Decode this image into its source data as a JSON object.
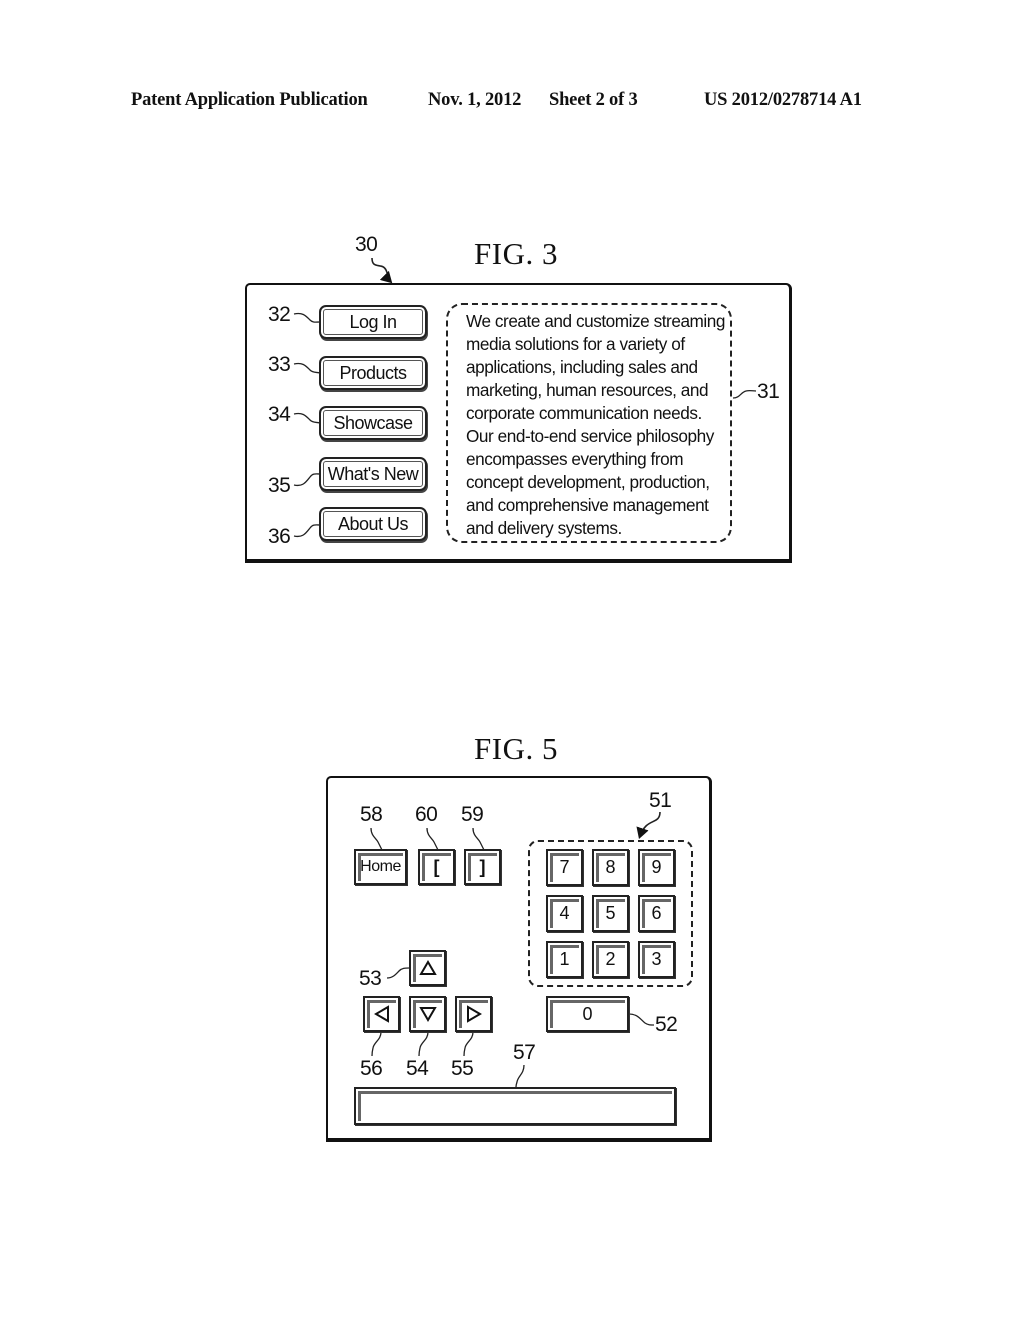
{
  "header": {
    "publication_type": "Patent Application Publication",
    "date": "Nov. 1, 2012",
    "sheet": "Sheet 2 of 3",
    "publication_number": "US 2012/0278714 A1"
  },
  "fig3": {
    "title": "FIG. 3",
    "ref_window": "30",
    "ref_text_area": "31",
    "nav_buttons": [
      {
        "ref": "32",
        "label": "Log In"
      },
      {
        "ref": "33",
        "label": "Products"
      },
      {
        "ref": "34",
        "label": "Showcase"
      },
      {
        "ref": "35",
        "label": "What's New"
      },
      {
        "ref": "36",
        "label": "About Us"
      }
    ],
    "text_lines": [
      "We create and customize streaming",
      "media solutions for a variety of",
      "applications, including sales and",
      "marketing, human resources, and",
      "corporate communication needs.",
      "Our end-to-end service philosophy",
      "encompasses everything from",
      "concept development, production,",
      "and comprehensive management",
      "and delivery systems."
    ]
  },
  "fig5": {
    "title": "FIG. 5",
    "ref_keypad": "51",
    "ref_zero": "52",
    "ref_up": "53",
    "ref_down": "54",
    "ref_right": "55",
    "ref_left": "56",
    "ref_text_field": "57",
    "ref_home": "58",
    "ref_right_bracket": "59",
    "ref_left_bracket": "60",
    "home_label": "Home",
    "left_bracket_label": "[",
    "right_bracket_label": "]",
    "keypad_keys": [
      "7",
      "8",
      "9",
      "4",
      "5",
      "6",
      "1",
      "2",
      "3"
    ],
    "zero_label": "0",
    "arrow_icons": {
      "up": "up-triangle",
      "down": "down-triangle",
      "left": "left-triangle",
      "right": "right-triangle"
    },
    "text_field_value": ""
  }
}
